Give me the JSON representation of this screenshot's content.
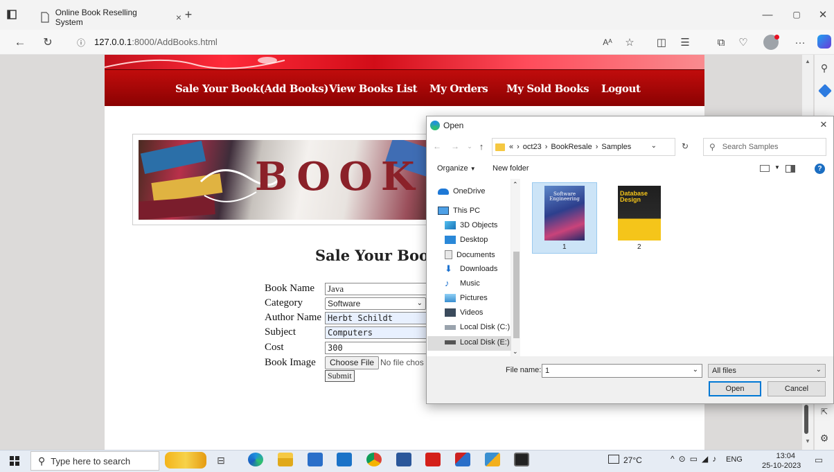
{
  "browser": {
    "tab_title": "Online Book Reselling System",
    "url_host": "127.0.0.1",
    "url_rest": ":8000/AddBooks.html"
  },
  "nav": {
    "items": [
      "Sale Your Book(Add Books)",
      "View Books List",
      "My Orders",
      "My Sold Books",
      "Logout"
    ]
  },
  "banner": {
    "text": "BOOK"
  },
  "form": {
    "title": "Sale Your Boo",
    "labels": {
      "book_name": "Book Name",
      "category": "Category",
      "author_name": "Author Name",
      "subject": "Subject",
      "cost": "Cost",
      "book_image": "Book Image"
    },
    "values": {
      "book_name": "Java",
      "category": "Software",
      "author_name": "Herbt Schildt",
      "subject": "Computers",
      "cost": "300"
    },
    "choose_file_label": "Choose File",
    "no_file_text": "No file chos",
    "submit_label": "Submit"
  },
  "dialog": {
    "title": "Open",
    "breadcrumb": [
      "«",
      "oct23",
      "BookResale",
      "Samples"
    ],
    "search_placeholder": "Search Samples",
    "organize_label": "Organize",
    "new_folder_label": "New folder",
    "tree": [
      "OneDrive",
      "This PC",
      "3D Objects",
      "Desktop",
      "Documents",
      "Downloads",
      "Music",
      "Pictures",
      "Videos",
      "Local Disk (C:)",
      "Local Disk (E:)"
    ],
    "files": [
      {
        "name": "1",
        "cover_title": "Software Engineering",
        "selected": true
      },
      {
        "name": "2",
        "cover_title": "Database Design",
        "selected": false
      }
    ],
    "file_name_label": "File name:",
    "file_name_value": "1",
    "filter": "All files",
    "open_label": "Open",
    "cancel_label": "Cancel"
  },
  "taskbar": {
    "search_placeholder": "Type here to search",
    "temperature": "27°C",
    "language": "ENG",
    "time": "13:04",
    "date": "25-10-2023"
  },
  "colors": {
    "nav_red": "#a30707",
    "dialog_selection": "#cce4f7",
    "open_button_border": "#0078d4"
  }
}
